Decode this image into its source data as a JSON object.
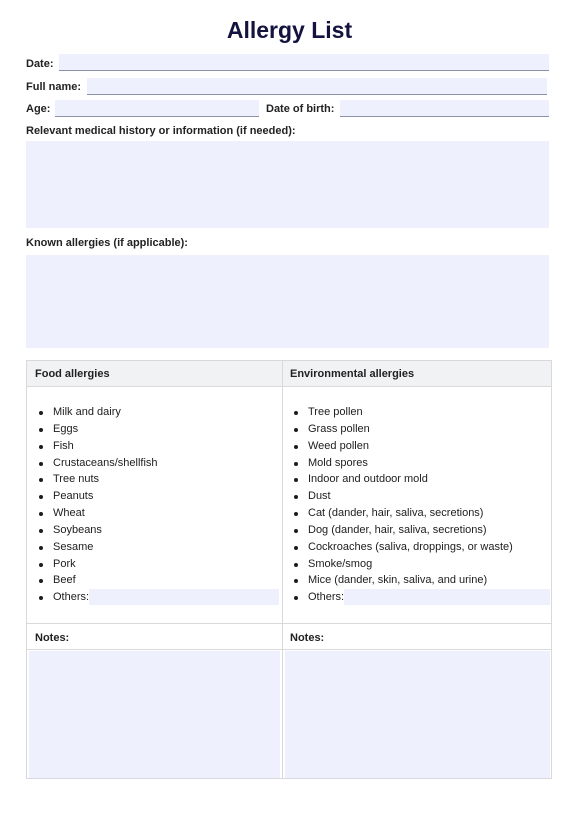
{
  "title": "Allergy List",
  "fields": {
    "date": {
      "label": "Date:",
      "value": ""
    },
    "full_name": {
      "label": "Full name:",
      "value": ""
    },
    "age": {
      "label": "Age:",
      "value": ""
    },
    "date_of_birth": {
      "label": "Date of birth:",
      "value": ""
    }
  },
  "sections": {
    "medical_history": {
      "label": "Relevant medical history or information (if needed):",
      "value": ""
    },
    "known_allergies": {
      "label": "Known allergies (if applicable):",
      "value": ""
    }
  },
  "table": {
    "food": {
      "header": "Food allergies",
      "items": [
        "Milk and dairy",
        "Eggs",
        "Fish",
        "Crustaceans/shellfish",
        "Tree nuts",
        "Peanuts",
        "Wheat",
        "Soybeans",
        "Sesame",
        "Pork",
        "Beef"
      ],
      "others_label": "Others:",
      "others_value": "",
      "notes_label": "Notes:",
      "notes_value": ""
    },
    "environmental": {
      "header": "Environmental allergies",
      "items": [
        "Tree pollen",
        "Grass pollen",
        "Weed pollen",
        "Mold spores",
        "Indoor and outdoor mold",
        "Dust",
        "Cat (dander, hair, saliva, secretions)",
        "Dog (dander, hair, saliva, secretions)",
        "Cockroaches (saliva, droppings, or waste)",
        "Smoke/smog",
        "Mice (dander, skin, saliva, and urine)"
      ],
      "others_label": "Others:",
      "others_value": "",
      "notes_label": "Notes:",
      "notes_value": ""
    }
  },
  "colors": {
    "title": "#14133f",
    "field_fill": "#eef1fd",
    "table_header_fill": "#f1f2f4",
    "border": "#d9d9dc"
  }
}
